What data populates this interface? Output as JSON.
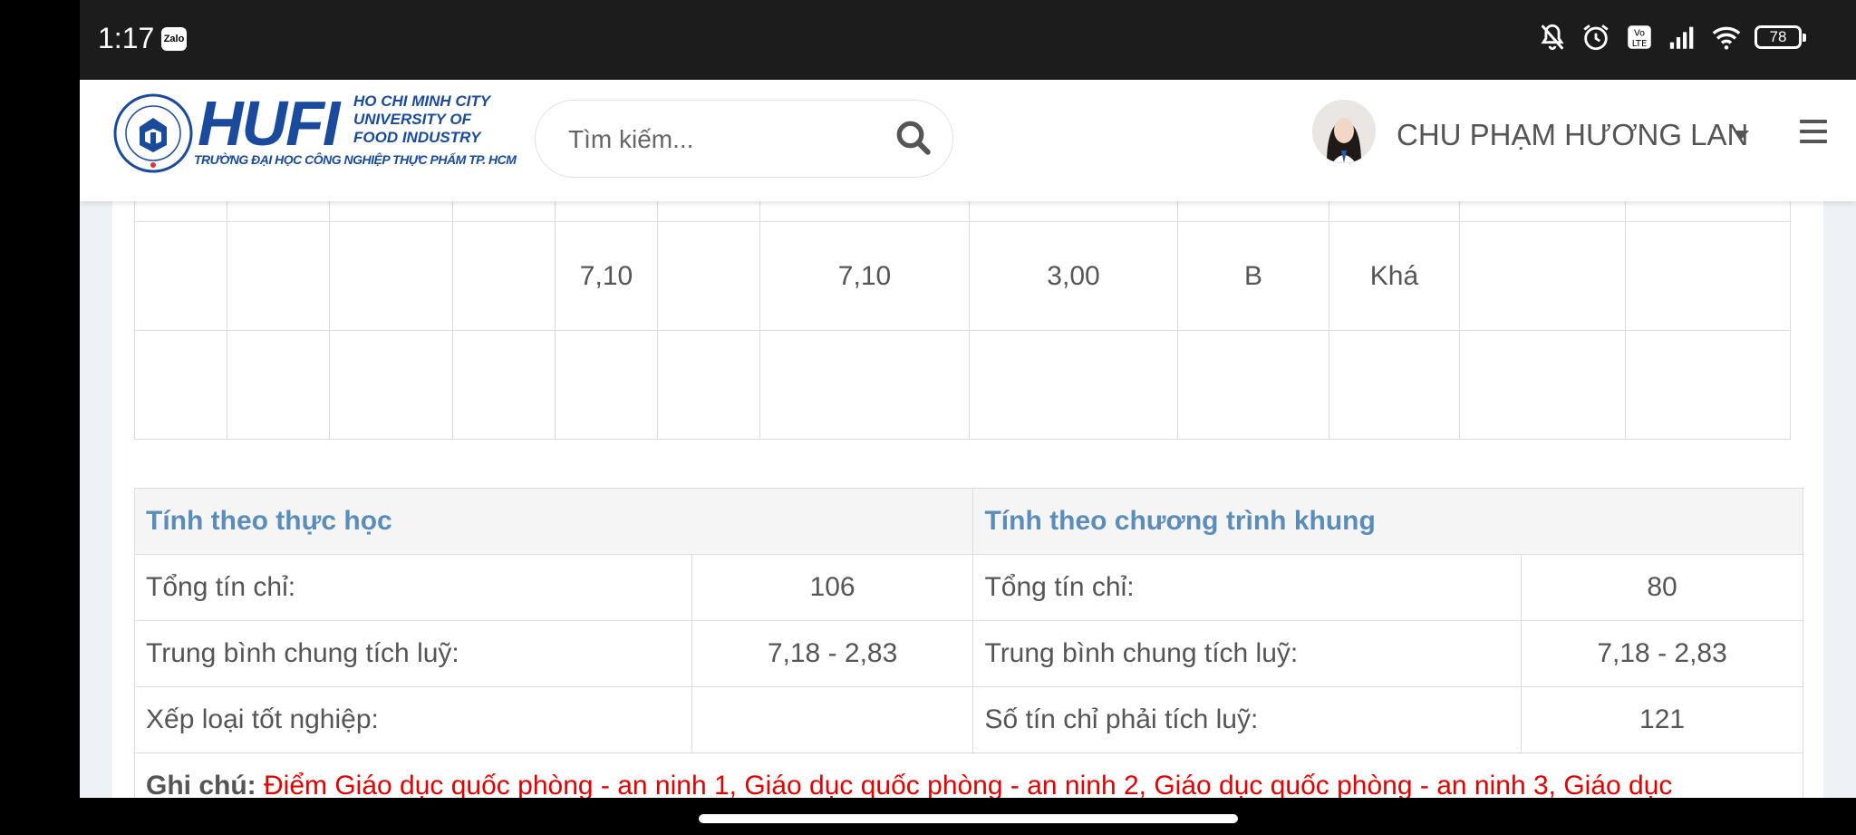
{
  "status_bar": {
    "time": "1:17",
    "app_badge": "Zalo",
    "battery": "78",
    "icons": [
      "bell-off-icon",
      "alarm-icon",
      "volte-icon",
      "signal-icon",
      "wifi-icon",
      "battery-icon"
    ]
  },
  "header": {
    "logo": {
      "brand": "HUFI",
      "sub_lines": [
        "HO CHI MINH CITY",
        "UNIVERSITY OF",
        "FOOD INDUSTRY"
      ],
      "vn_name": "TRƯỜNG ĐẠI HỌC CÔNG NGHIỆP THỰC PHẨM TP. HCM"
    },
    "search": {
      "placeholder": "Tìm kiếm..."
    },
    "user": {
      "name": "CHU PHẠM HƯƠNG LAN"
    }
  },
  "grade_table": {
    "rows": [
      [
        "",
        "",
        "",
        "",
        "7,10",
        "",
        "7,10",
        "3,00",
        "B",
        "Khá",
        "",
        ""
      ],
      [
        "",
        "",
        "",
        "",
        "",
        "",
        "",
        "",
        "",
        "",
        "",
        ""
      ]
    ]
  },
  "summary": {
    "left_title": "Tính theo thực học",
    "right_title": "Tính theo chương trình khung",
    "rows": [
      {
        "l_label": "Tổng tín chỉ:",
        "l_value": "106",
        "r_label": "Tổng tín chỉ:",
        "r_value": "80"
      },
      {
        "l_label": "Trung bình chung tích luỹ:",
        "l_value": "7,18 - 2,83",
        "r_label": "Trung bình chung tích luỹ:",
        "r_value": "7,18 - 2,83"
      },
      {
        "l_label": "Xếp loại tốt nghiệp:",
        "l_value": "",
        "r_label": "Số tín chỉ phải tích luỹ:",
        "r_value": "121"
      }
    ],
    "note_label": "Ghi chú:",
    "note_text": "Điểm Giáo dục quốc phòng - an ninh 1, Giáo dục quốc phòng - an ninh 2, Giáo dục quốc phòng - an ninh 3, Giáo dục"
  },
  "colors": {
    "brand_blue": "#1a4a9c",
    "heading_blue": "#5b8dba",
    "note_red": "#e00000",
    "page_bg": "#eef1f5"
  }
}
